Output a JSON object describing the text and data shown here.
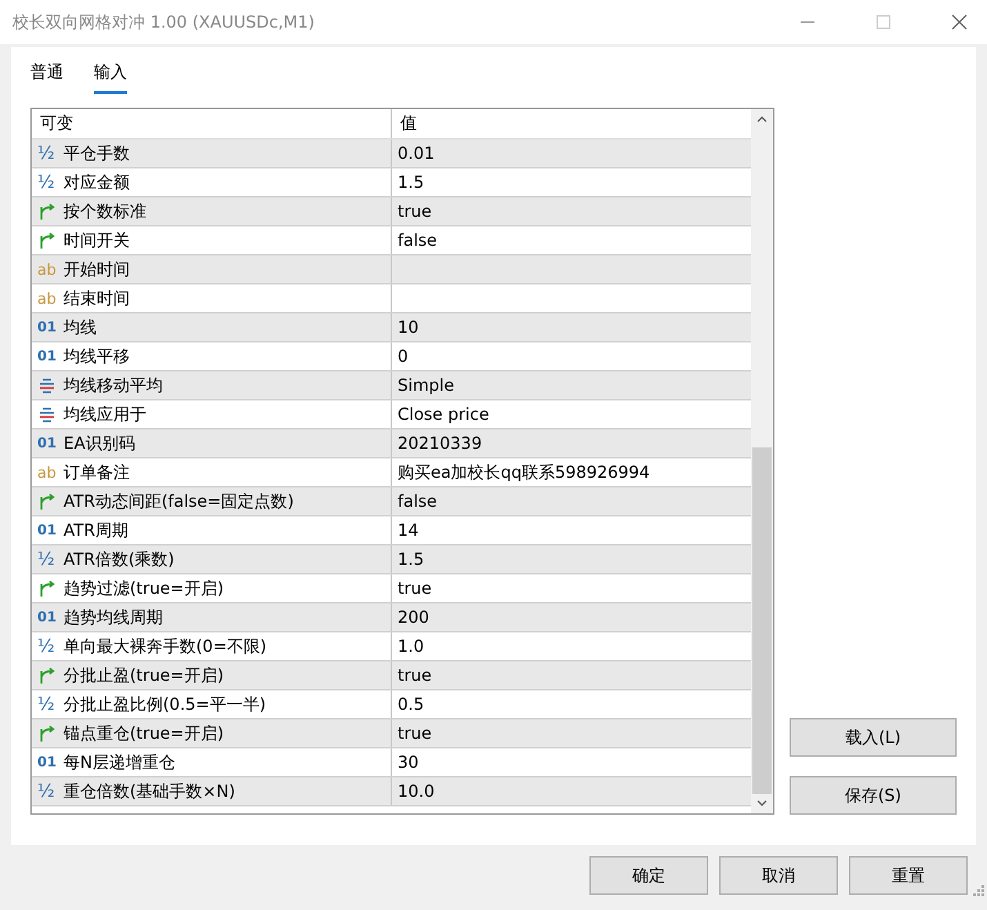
{
  "window": {
    "title": "校长双向网格对冲 1.00 (XAUUSDc,M1)"
  },
  "tabs": [
    {
      "label": "普通",
      "selected": false
    },
    {
      "label": "输入",
      "selected": true
    }
  ],
  "table": {
    "columns": [
      "可变",
      "值"
    ],
    "rows": [
      {
        "kind": "double",
        "icon": "½",
        "name": "平仓手数",
        "value": "0.01"
      },
      {
        "kind": "double",
        "icon": "½",
        "name": "对应金额",
        "value": "1.5"
      },
      {
        "kind": "bool",
        "name": "按个数标准",
        "value": "true"
      },
      {
        "kind": "bool",
        "name": "时间开关",
        "value": "false"
      },
      {
        "kind": "string",
        "icon": "ab",
        "name": "开始时间"
      },
      {
        "kind": "string",
        "icon": "ab",
        "name": "结束时间"
      },
      {
        "kind": "int",
        "icon": "01",
        "name": "均线",
        "value": "10"
      },
      {
        "kind": "int",
        "icon": "01",
        "name": "均线平移",
        "value": "0"
      },
      {
        "kind": "enum",
        "name": "均线移动平均",
        "value": "Simple"
      },
      {
        "kind": "enum",
        "name": "均线应用于",
        "value": "Close price"
      },
      {
        "kind": "int",
        "icon": "01",
        "name": "EA识别码",
        "value": "20210339"
      },
      {
        "kind": "string",
        "icon": "ab",
        "name": "订单备注",
        "value": "购买ea加校长qq联系598926994"
      },
      {
        "kind": "bool",
        "name": "ATR动态间距(false=固定点数)",
        "value": "false"
      },
      {
        "kind": "int",
        "icon": "01",
        "name": "ATR周期",
        "value": "14"
      },
      {
        "kind": "double",
        "icon": "½",
        "name": "ATR倍数(乘数)",
        "value": "1.5"
      },
      {
        "kind": "bool",
        "name": "趋势过滤(true=开启)",
        "value": "true"
      },
      {
        "kind": "int",
        "icon": "01",
        "name": "趋势均线周期",
        "value": "200"
      },
      {
        "kind": "double",
        "icon": "½",
        "name": "单向最大裸奔手数(0=不限)",
        "value": "1.0"
      },
      {
        "kind": "bool",
        "name": "分批止盈(true=开启)",
        "value": "true"
      },
      {
        "kind": "double",
        "icon": "½",
        "name": "分批止盈比例(0.5=平一半)",
        "value": "0.5"
      },
      {
        "kind": "bool",
        "name": "锚点重仓(true=开启)",
        "value": "true"
      },
      {
        "kind": "int",
        "icon": "01",
        "name": "每N层递增重仓",
        "value": "30"
      },
      {
        "kind": "double",
        "icon": "½",
        "name": "重仓倍数(基础手数×N)",
        "value": "10.0"
      }
    ]
  },
  "side_buttons": [
    "载入(L)",
    "保存(S)"
  ],
  "buttons": [
    "确定",
    "取消",
    "重置"
  ]
}
